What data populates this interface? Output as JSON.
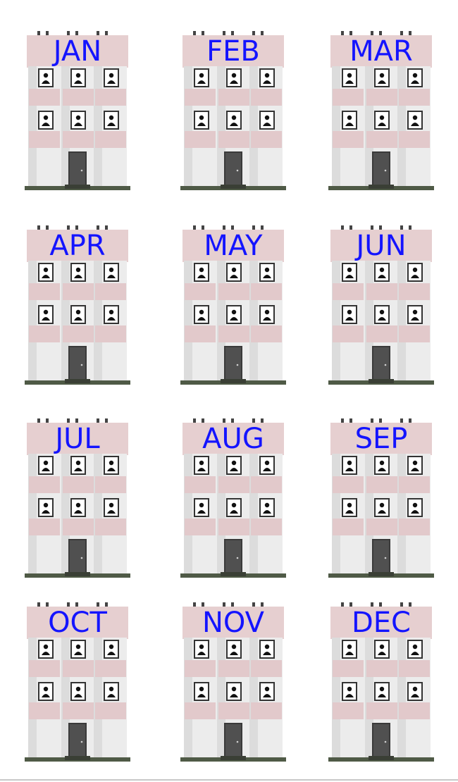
{
  "months": [
    {
      "label": "JAN"
    },
    {
      "label": "FEB"
    },
    {
      "label": "MAR"
    },
    {
      "label": "APR"
    },
    {
      "label": "MAY"
    },
    {
      "label": "JUN"
    },
    {
      "label": "JUL"
    },
    {
      "label": "AUG"
    },
    {
      "label": "SEP"
    },
    {
      "label": "OCT"
    },
    {
      "label": "NOV"
    },
    {
      "label": "DEC"
    }
  ],
  "icon": "apartment-building-icon",
  "colors": {
    "label": "#1414ff",
    "sign": "#e6cfd0",
    "balcony": "#e2c9cb",
    "facade": "#ececec",
    "door": "#505050",
    "ground": "#4f5a46"
  }
}
